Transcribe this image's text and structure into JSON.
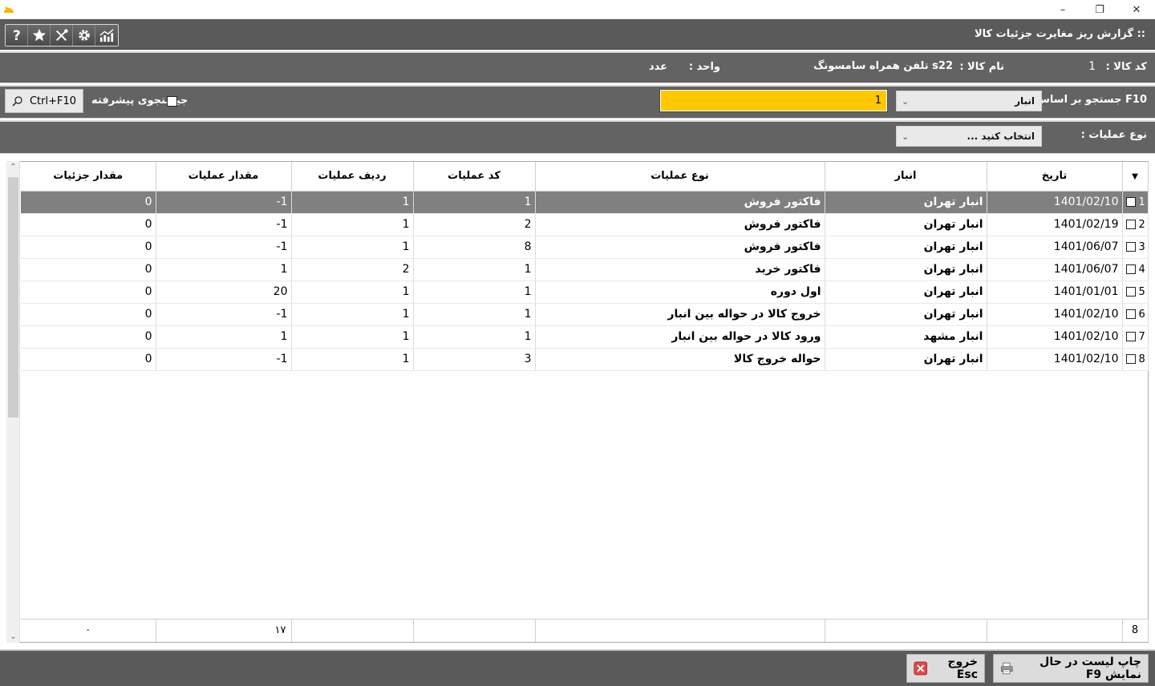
{
  "window": {
    "min_symbol": "–",
    "restore_symbol": "❐",
    "close_symbol": "✕"
  },
  "toolbar": {
    "title": ":: گزارش ریز مغایرت جزئیات کالا",
    "icons": [
      "help-icon",
      "star-icon",
      "tools-icon",
      "gear-icon",
      "chart-icon"
    ]
  },
  "info": {
    "code_label": "کد کالا :",
    "code_value": "1",
    "name_label": "نام کالا :",
    "name_value": "s22 تلفن همراه سامسونگ",
    "unit_label": "واحد :",
    "unit_value": "عدد"
  },
  "search": {
    "label": "F10 جستجو بر اساس :",
    "field_combo": "انبار",
    "input_value": "1",
    "advanced_label": "جیستجوی پیشرفته",
    "button_label": "Ctrl+F10"
  },
  "filter": {
    "label": "نوع عملیات :",
    "combo_value": "انتخاب کنید ..."
  },
  "grid": {
    "columns": {
      "date": "تاریخ",
      "warehouse": "انبار",
      "op_type": "نوع عملیات",
      "op_code": "کد عملیات",
      "op_row": "ردیف عملیات",
      "op_qty": "مقدار عملیات",
      "detail_qty": "مقدار جزئیات"
    },
    "rows": [
      {
        "idx": "1",
        "date": "1401/02/10",
        "warehouse": "انبار تهران",
        "op_type": "فاکتور فروش",
        "op_code": "1",
        "op_row": "1",
        "op_qty": "-1",
        "detail_qty": "0"
      },
      {
        "idx": "2",
        "date": "1401/02/19",
        "warehouse": "انبار تهران",
        "op_type": "فاکتور فروش",
        "op_code": "2",
        "op_row": "1",
        "op_qty": "-1",
        "detail_qty": "0"
      },
      {
        "idx": "3",
        "date": "1401/06/07",
        "warehouse": "انبار تهران",
        "op_type": "فاکتور فروش",
        "op_code": "8",
        "op_row": "1",
        "op_qty": "-1",
        "detail_qty": "0"
      },
      {
        "idx": "4",
        "date": "1401/06/07",
        "warehouse": "انبار تهران",
        "op_type": "فاکتور خرید",
        "op_code": "1",
        "op_row": "2",
        "op_qty": "1",
        "detail_qty": "0"
      },
      {
        "idx": "5",
        "date": "1401/01/01",
        "warehouse": "انبار تهران",
        "op_type": "اول دوره",
        "op_code": "1",
        "op_row": "1",
        "op_qty": "20",
        "detail_qty": "0"
      },
      {
        "idx": "6",
        "date": "1401/02/10",
        "warehouse": "انبار تهران",
        "op_type": "خروج کالا در حواله بین انبار",
        "op_code": "1",
        "op_row": "1",
        "op_qty": "-1",
        "detail_qty": "0"
      },
      {
        "idx": "7",
        "date": "1401/02/10",
        "warehouse": "انبار مشهد",
        "op_type": "ورود کالا در حواله بین انبار",
        "op_code": "1",
        "op_row": "1",
        "op_qty": "1",
        "detail_qty": "0"
      },
      {
        "idx": "8",
        "date": "1401/02/10",
        "warehouse": "انبار تهران",
        "op_type": "حواله خروج کالا",
        "op_code": "3",
        "op_row": "1",
        "op_qty": "-1",
        "detail_qty": "0"
      }
    ],
    "footer": {
      "count": "8",
      "op_qty_sum": "۱۷",
      "detail_qty_sum": "۰"
    }
  },
  "bottom": {
    "print_label": "چاپ لیست در حال نمایش F9",
    "exit_label": "خروج Esc"
  }
}
